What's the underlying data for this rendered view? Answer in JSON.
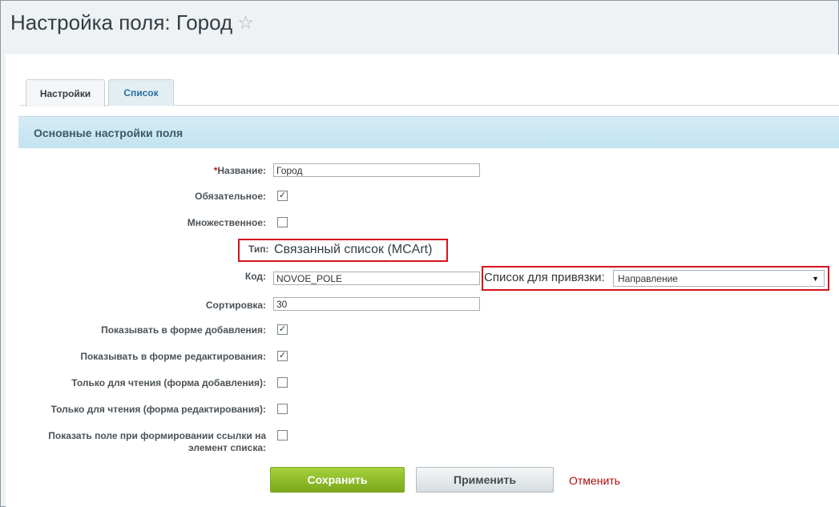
{
  "page": {
    "title": "Настройка поля: Город"
  },
  "tabs": [
    {
      "label": "Настройки"
    },
    {
      "label": "Список"
    }
  ],
  "section": {
    "title": "Основные настройки поля"
  },
  "form": {
    "name": {
      "label": "Название:",
      "required_mark": "*",
      "value": "Город"
    },
    "mandatory": {
      "label": "Обязательное:",
      "checked": "✓"
    },
    "multiple": {
      "label": "Множественное:",
      "checked": ""
    },
    "type": {
      "label": "Тип:",
      "value": "Связанный список (MCArt)"
    },
    "code": {
      "label": "Код:",
      "value": "NOVOE_POLE"
    },
    "bind_list": {
      "label": "Список для привязки:",
      "selected": "Направление"
    },
    "sort": {
      "label": "Сортировка:",
      "value": "30"
    },
    "show_add": {
      "label": "Показывать в форме добавления:",
      "checked": "✓"
    },
    "show_edit": {
      "label": "Показывать в форме редактирования:",
      "checked": "✓"
    },
    "readonly_add": {
      "label": "Только для чтения (форма добавления):",
      "checked": ""
    },
    "readonly_edit": {
      "label": "Только для чтения (форма редактирования):",
      "checked": ""
    },
    "show_link": {
      "label_line1": "Показать поле при формировании ссылки на",
      "label_line2": "элемент списка:",
      "checked": ""
    }
  },
  "buttons": {
    "save": "Сохранить",
    "apply": "Применить",
    "cancel": "Отменить"
  },
  "icons": {
    "favorite": "star-icon",
    "dropdown": "caret-down-icon"
  }
}
